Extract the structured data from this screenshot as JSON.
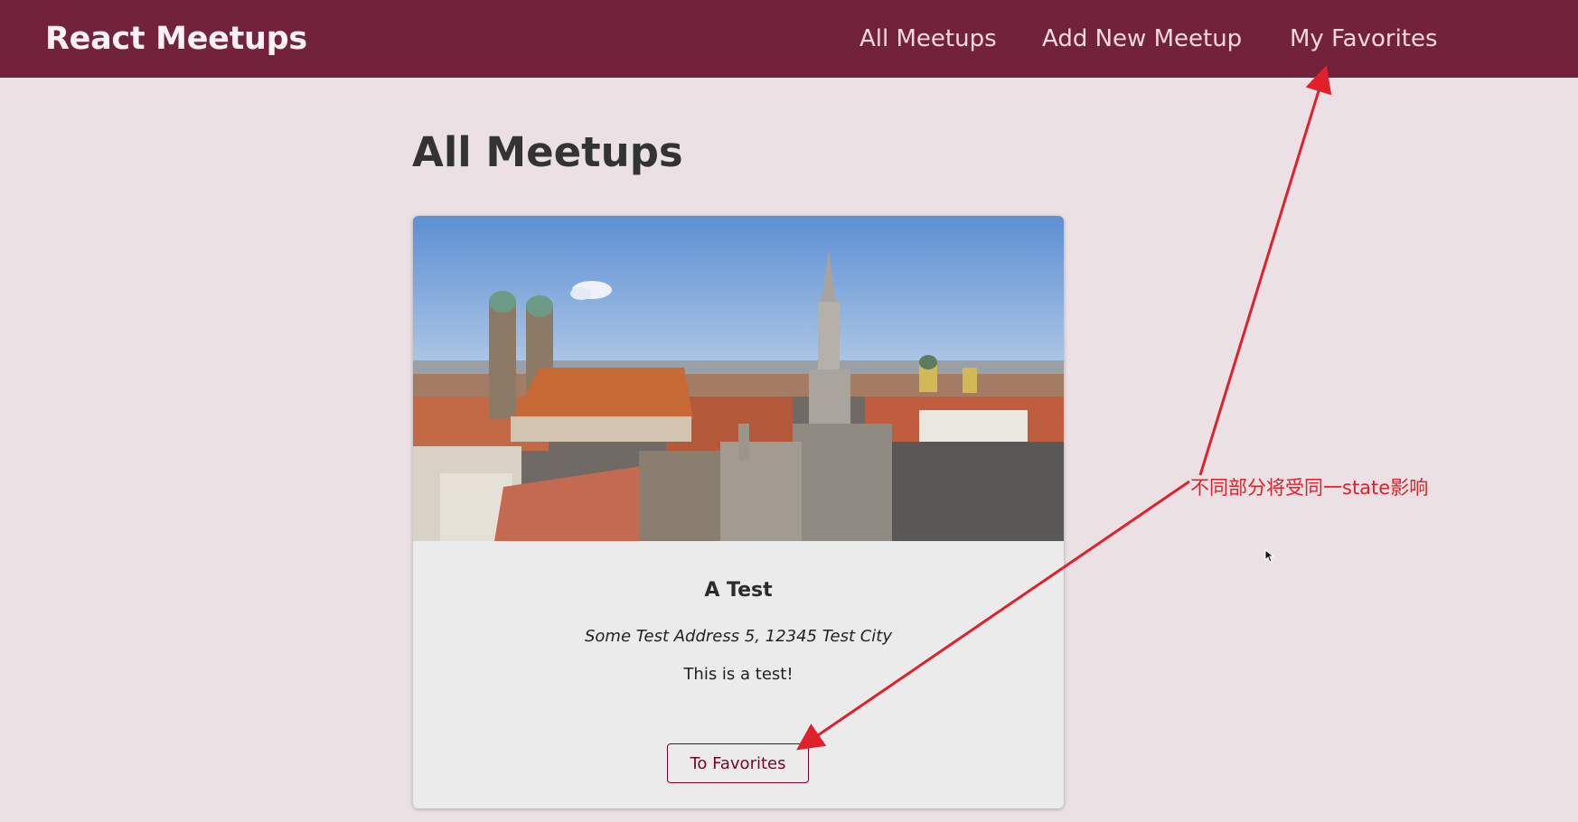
{
  "header": {
    "logo": "React Meetups",
    "nav": [
      {
        "label": "All Meetups"
      },
      {
        "label": "Add New Meetup"
      },
      {
        "label": "My Favorites"
      }
    ]
  },
  "main": {
    "title": "All Meetups",
    "meetups": [
      {
        "title": "A Test",
        "address": "Some Test Address 5, 12345 Test City",
        "description": "This is a test!",
        "button_label": "To Favorites"
      }
    ]
  },
  "annotation": {
    "text": "不同部分将受同一state影响",
    "color": "#e0202a"
  },
  "colors": {
    "header_bg": "#72223a",
    "page_bg": "#ebe1e5",
    "accent": "#77002e"
  }
}
